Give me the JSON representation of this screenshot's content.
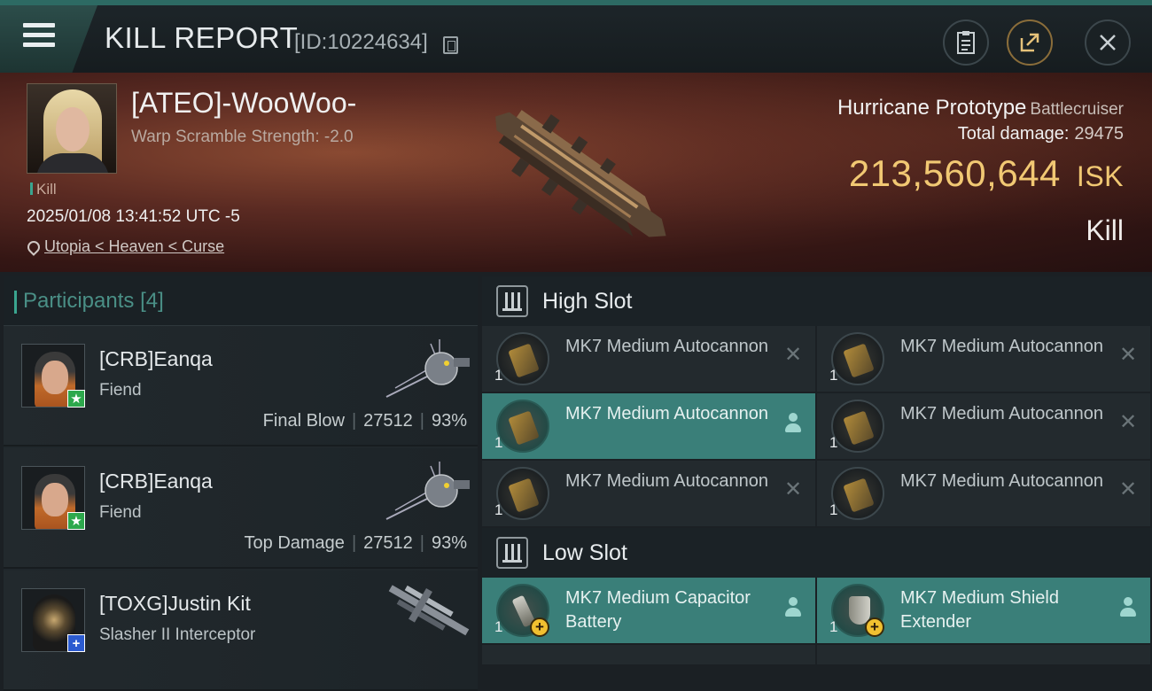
{
  "header": {
    "title": "KILL REPORT",
    "report_id": "[ID:10224634]",
    "buttons": [
      "clipboard-icon",
      "share-icon",
      "close-icon"
    ]
  },
  "victim": {
    "name": "[ATEO]-WooWoo-",
    "subtitle": "Warp Scramble Strength: -2.0",
    "kill_tag": "Kill",
    "time": "2025/01/08 13:41:52 UTC -5",
    "location": "Utopia < Heaven < Curse",
    "ship_name": "Hurricane Prototype",
    "ship_class": "Battlecruiser",
    "total_damage_label": "Total damage:",
    "total_damage": "29475",
    "isk_value": "213,560,644",
    "isk_unit": "ISK",
    "result": "Kill"
  },
  "participants": {
    "title": "Participants",
    "count": "[4]",
    "rows": [
      {
        "name": "[CRB]Eanqa",
        "ship": "Fiend",
        "role": "Final Blow",
        "damage": "27512",
        "percent": "93%",
        "badge": "★"
      },
      {
        "name": "[CRB]Eanqa",
        "ship": "Fiend",
        "role": "Top Damage",
        "damage": "27512",
        "percent": "93%",
        "badge": "★"
      },
      {
        "name": "[TOXG]Justin Kit",
        "ship": "Slasher II Interceptor",
        "badge": "+"
      }
    ]
  },
  "high_slot": {
    "title": "High Slot",
    "modules": [
      {
        "name": "MK7 Medium Autocannon",
        "qty": "1"
      },
      {
        "name": "MK7 Medium Autocannon",
        "qty": "1"
      },
      {
        "name": "MK7 Medium Autocannon",
        "qty": "1"
      },
      {
        "name": "MK7 Medium Autocannon",
        "qty": "1"
      },
      {
        "name": "MK7 Medium Autocannon",
        "qty": "1"
      },
      {
        "name": "MK7 Medium Autocannon",
        "qty": "1"
      }
    ]
  },
  "low_slot": {
    "title": "Low Slot",
    "modules": [
      {
        "name": "MK7 Medium Capacitor Battery",
        "qty": "1"
      },
      {
        "name": "MK7 Medium Shield Extender",
        "qty": "1"
      }
    ]
  },
  "colors": {
    "accent_teal": "#3a7f79",
    "isk_gold": "#f1c873",
    "badge_green": "#2da84c",
    "badge_blue": "#2c5bd0"
  }
}
